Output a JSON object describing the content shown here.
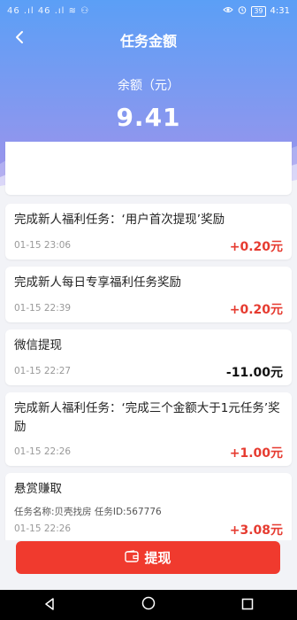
{
  "status_bar": {
    "left_text": "46 .ıl 46 .ıl ≋ ⚇",
    "battery": "39",
    "time": "4:31"
  },
  "header": {
    "title": "任务金额",
    "balance_label": "余额（元）",
    "balance_value": "9.41"
  },
  "records": [
    {
      "title": "完成新人福利任务：‘用户首次提现’奖励",
      "time": "01-15 23:06",
      "amount": "+0.20元",
      "type": "income"
    },
    {
      "title": "完成新人每日专享福利任务奖励",
      "time": "01-15 22:39",
      "amount": "+0.20元",
      "type": "income"
    },
    {
      "title": "微信提现",
      "time": "01-15 22:27",
      "amount": "-11.00元",
      "type": "expense"
    },
    {
      "title": "完成新人福利任务：‘完成三个金额大于1元任务’奖励",
      "time": "01-15 22:26",
      "amount": "+1.00元",
      "type": "income"
    },
    {
      "title": "悬赏赚取",
      "subtitle": "任务名称:贝壳找房   任务ID:567776",
      "time": "01-15 22:26",
      "amount": "+3.08元",
      "type": "income"
    }
  ],
  "withdraw_button": {
    "label": "提现"
  },
  "colors": {
    "accent": "#f03a2e",
    "income": "#e63b30",
    "header_top": "#5b9ff6",
    "header_bottom": "#a492ea"
  },
  "icons": {
    "back": "chevron-left-icon",
    "withdraw": "wallet-icon"
  }
}
